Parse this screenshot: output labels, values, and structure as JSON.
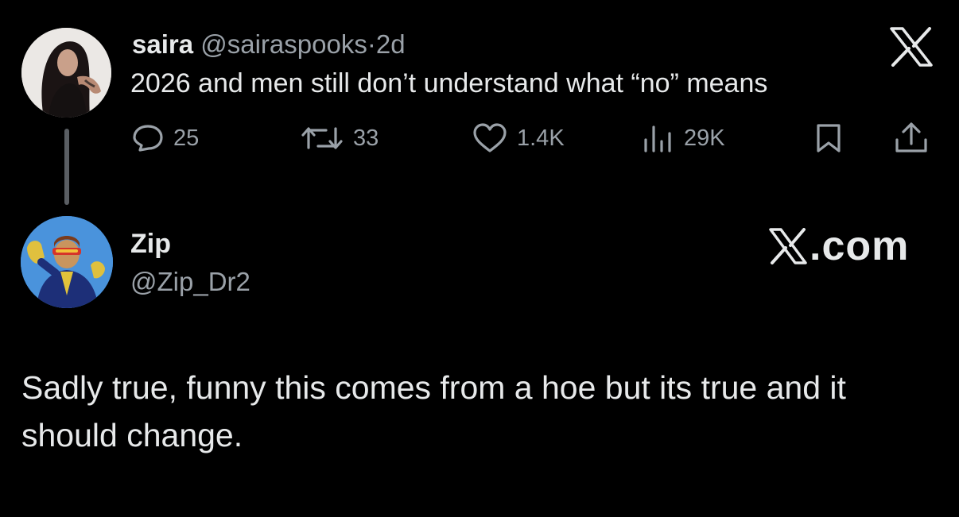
{
  "parent_tweet": {
    "display_name": "saira",
    "handle": "@sairaspooks",
    "separator": "·",
    "time_ago": "2d",
    "text": "2026 and men still don’t understand what “no” means",
    "avatar_icon": "user-avatar-dark-hair",
    "actions": {
      "reply_count": "25",
      "retweet_count": "33",
      "like_count": "1.4K",
      "view_count": "29K"
    },
    "icons": [
      "reply-icon",
      "retweet-icon",
      "like-icon",
      "views-icon",
      "bookmark-icon",
      "share-icon"
    ]
  },
  "reply": {
    "display_name": "Zip",
    "handle": "@Zip_Dr2",
    "avatar_icon": "comic-hero-avatar",
    "text": "Sadly true, funny this comes from a hoe but its true and it should change."
  },
  "branding": {
    "top_logo_icon": "x-logo-icon",
    "site_label": ".com"
  },
  "colors": {
    "background": "#000000",
    "primary_text": "#e7e9ea",
    "secondary_text": "#9aa1a8",
    "thread_line": "#5a5e63"
  }
}
